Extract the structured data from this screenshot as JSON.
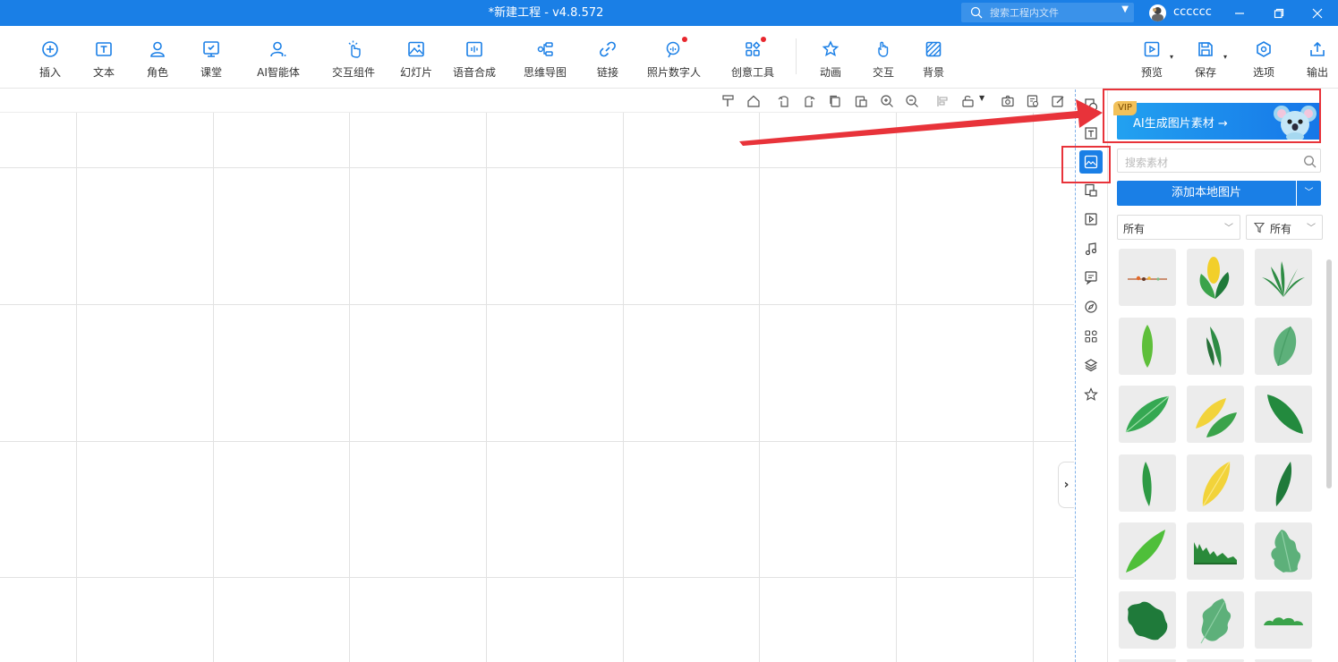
{
  "window": {
    "title": "*新建工程 - v4.8.572",
    "search_placeholder": "搜索工程内文件",
    "username": "cccccc"
  },
  "toolbar": {
    "items": [
      {
        "label": "插入",
        "icon": "plus-circle-icon"
      },
      {
        "label": "文本",
        "icon": "text-icon"
      },
      {
        "label": "角色",
        "icon": "character-icon"
      },
      {
        "label": "课堂",
        "icon": "classroom-icon"
      },
      {
        "label": "AI智能体",
        "icon": "ai-agent-icon"
      },
      {
        "label": "交互组件",
        "icon": "interactive-component-icon"
      },
      {
        "label": "幻灯片",
        "icon": "slide-icon"
      },
      {
        "label": "语音合成",
        "icon": "speech-synthesis-icon"
      },
      {
        "label": "思维导图",
        "icon": "mind-map-icon"
      },
      {
        "label": "链接",
        "icon": "link-icon"
      },
      {
        "label": "照片数字人",
        "icon": "digital-human-icon"
      },
      {
        "label": "创意工具",
        "icon": "creative-tools-icon"
      },
      {
        "label": "动画",
        "icon": "animation-star-icon"
      },
      {
        "label": "交互",
        "icon": "interaction-hand-icon"
      },
      {
        "label": "背景",
        "icon": "background-icon"
      }
    ],
    "right_items": [
      {
        "label": "预览",
        "icon": "preview-icon"
      },
      {
        "label": "保存",
        "icon": "save-icon"
      },
      {
        "label": "选项",
        "icon": "options-icon"
      },
      {
        "label": "输出",
        "icon": "export-icon"
      }
    ]
  },
  "panel": {
    "vip_badge": "VIP",
    "ai_banner_label": "AI生成图片素材 →",
    "search_placeholder": "搜索素材",
    "add_local_label": "添加本地图片",
    "filter_category": "所有",
    "filter_type": "所有",
    "thumbnails": [
      "flower-strip-image",
      "yellow-green-leaves-image",
      "grass-tuft-image",
      "leaf-image",
      "grass-blades-image",
      "pale-leaf-image",
      "green-leaf-image",
      "yellow-leaf-pair-image",
      "dark-leaf-image",
      "narrow-leaf-image",
      "yellow-leaf-image",
      "thin-leaf-image",
      "long-leaf-image",
      "grass-ground-image",
      "oak-leaf-image",
      "dark-oak-leaf-image",
      "light-oak-leaf-image",
      "bush-image"
    ]
  },
  "colors": {
    "brand_blue": "#1a7fe6",
    "annotation_red": "#e8333a"
  }
}
